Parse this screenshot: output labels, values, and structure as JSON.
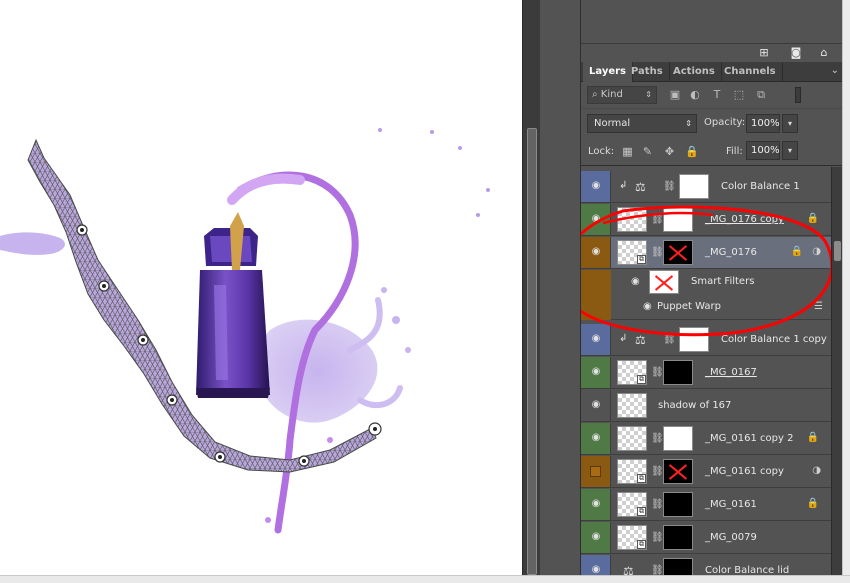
{
  "panel": {
    "icons": [
      "new-layer-icon",
      "camera-icon",
      "trash-icon"
    ],
    "tabs": [
      {
        "label": "Layers",
        "active": true
      },
      {
        "label": "Paths",
        "active": false
      },
      {
        "label": "Actions",
        "active": false
      },
      {
        "label": "Channels",
        "active": false
      }
    ],
    "filter": {
      "kind_label": "Kind"
    },
    "blend_mode": "Normal",
    "opacity_label": "Opacity:",
    "opacity_value": "100%",
    "lock_label": "Lock:",
    "fill_label": "Fill:",
    "fill_value": "100%"
  },
  "layers": [
    {
      "name": "Color Balance 1",
      "color_tag": "#5a6b9e"
    },
    {
      "name": "_MG_0176 copy",
      "color_tag": "#4f7a45"
    },
    {
      "name": "_MG_0176",
      "color_tag": "#8a5a12",
      "selected": true
    },
    {
      "sub_name": "Smart Filters"
    },
    {
      "sub_name": "Puppet Warp"
    },
    {
      "name": "Color Balance 1 copy",
      "color_tag": "#5a6b9e"
    },
    {
      "name": "_MG_0167",
      "color_tag": "#4f7a45"
    },
    {
      "name": "shadow of 167"
    },
    {
      "name": "_MG_0161 copy 2",
      "color_tag": "#4f7a45"
    },
    {
      "name": "_MG_0161 copy",
      "color_tag": "#8a5a12"
    },
    {
      "name": "_MG_0161",
      "color_tag": "#4f7a45"
    },
    {
      "name": "_MG_0079",
      "color_tag": "#4f7a45"
    },
    {
      "name": "Color Balance lid",
      "color_tag": "#5a6b9e"
    }
  ],
  "colors": {
    "panel_bg": "#535353",
    "selected_row": "#6a6f7e",
    "annotation_red": "#ff0000",
    "splash_purple": "#b07de0"
  }
}
